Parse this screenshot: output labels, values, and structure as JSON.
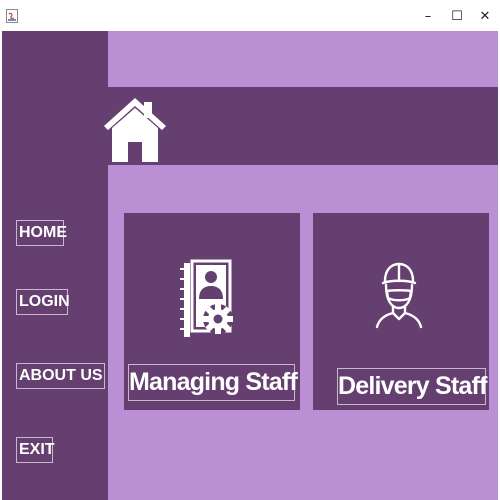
{
  "window": {
    "minimize_glyph": "–",
    "maximize_glyph": "☐",
    "close_glyph": "✕"
  },
  "sidebar": {
    "items": [
      {
        "label": "HOME"
      },
      {
        "label": "LOGIN"
      },
      {
        "label": "ABOUT US"
      },
      {
        "label": "EXIT"
      }
    ]
  },
  "cards": [
    {
      "label": "Managing Staff",
      "icon": "staff-directory-gear-icon"
    },
    {
      "label": "Delivery Staff",
      "icon": "delivery-person-icon"
    }
  ],
  "header": {
    "icon": "home-icon"
  },
  "colors": {
    "sidebar": "#643f6f",
    "background": "#bb8fd3",
    "card": "#643f6f",
    "text": "#ffffff"
  }
}
